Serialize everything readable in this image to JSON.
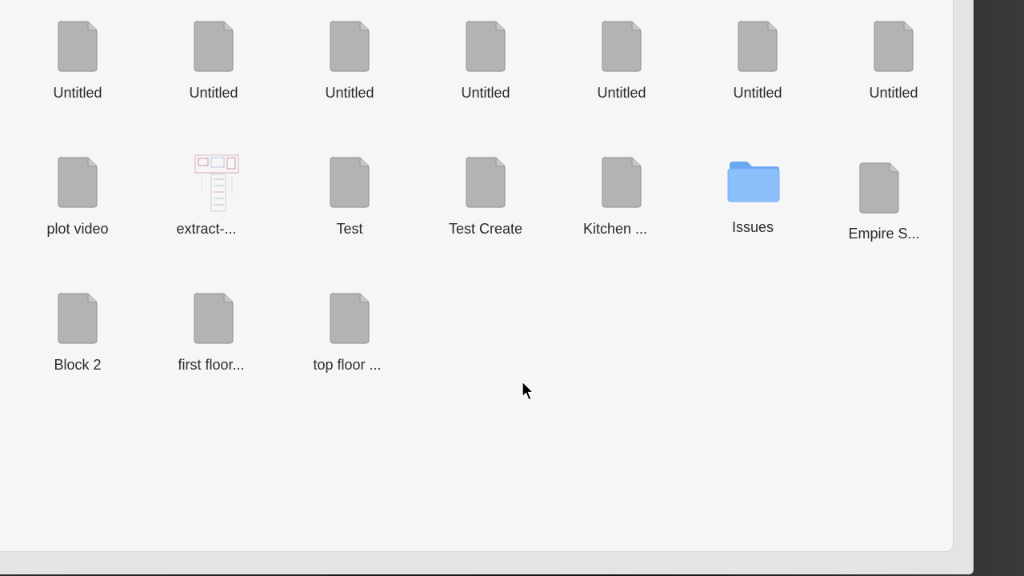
{
  "items": [
    {
      "label": "Untitled",
      "type": "file"
    },
    {
      "label": "Untitled",
      "type": "file"
    },
    {
      "label": "Untitled",
      "type": "file"
    },
    {
      "label": "Untitled",
      "type": "file"
    },
    {
      "label": "Untitled",
      "type": "file"
    },
    {
      "label": "Untitled",
      "type": "file"
    },
    {
      "label": "Untitled",
      "type": "file"
    },
    {
      "label": "plot video",
      "type": "file"
    },
    {
      "label": "extract-...",
      "type": "thumbnail"
    },
    {
      "label": "Test",
      "type": "file"
    },
    {
      "label": "Test Create",
      "type": "file"
    },
    {
      "label": "Kitchen ...",
      "type": "file"
    },
    {
      "label": "Issues",
      "type": "folder"
    },
    {
      "label": "Empire S...",
      "type": "file"
    },
    {
      "label": "Block 2",
      "type": "file"
    },
    {
      "label": "first floor...",
      "type": "file"
    },
    {
      "label": "top floor ...",
      "type": "file"
    }
  ],
  "colors": {
    "file_icon": "#b3b3b3",
    "file_icon_border": "#9a9a9a",
    "folder_icon": "#8cc0fb",
    "folder_icon_dark": "#6aa8f2",
    "background": "#f6f6f6"
  },
  "icons": {
    "file": "document-icon",
    "folder": "folder-icon",
    "thumbnail": "floorplan-thumbnail",
    "cursor": "mouse-pointer-icon"
  }
}
